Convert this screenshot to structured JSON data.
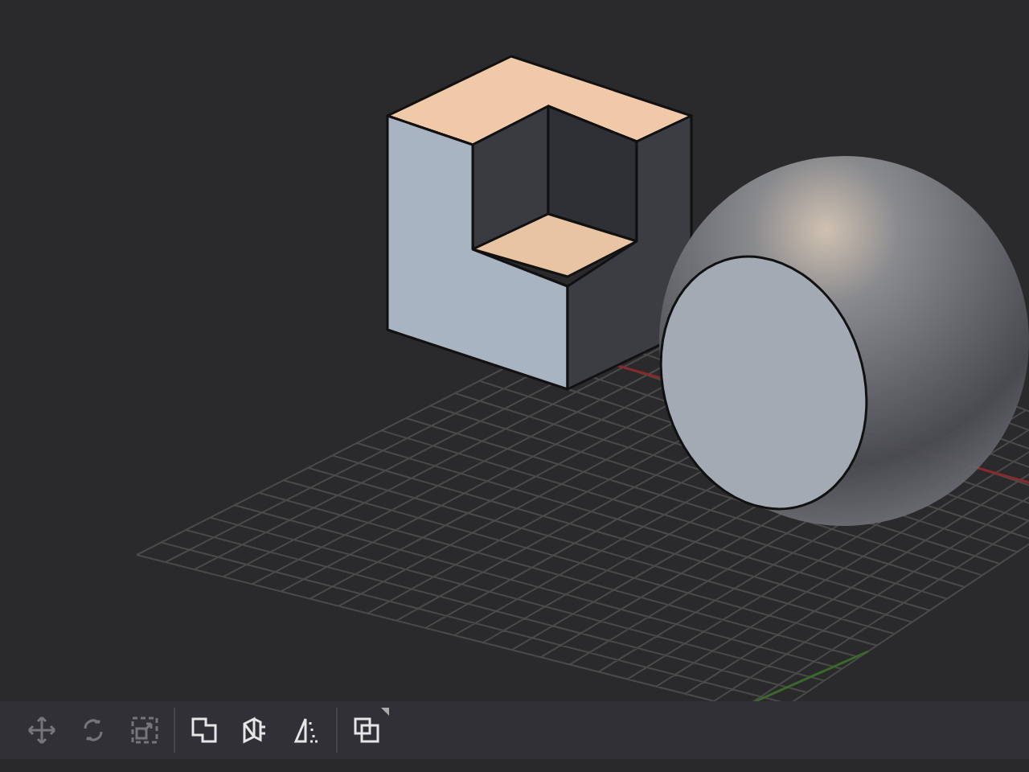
{
  "toolbar": {
    "groups": [
      {
        "tools": [
          {
            "kind": "move",
            "disabled": true
          },
          {
            "kind": "rotate",
            "disabled": true
          },
          {
            "kind": "scale",
            "disabled": true
          }
        ]
      },
      {
        "tools": [
          {
            "kind": "union",
            "disabled": false
          },
          {
            "kind": "extrude",
            "disabled": false
          },
          {
            "kind": "mirror",
            "disabled": false
          }
        ]
      },
      {
        "tools": [
          {
            "kind": "stack",
            "disabled": false,
            "has_menu": true
          }
        ]
      }
    ]
  }
}
